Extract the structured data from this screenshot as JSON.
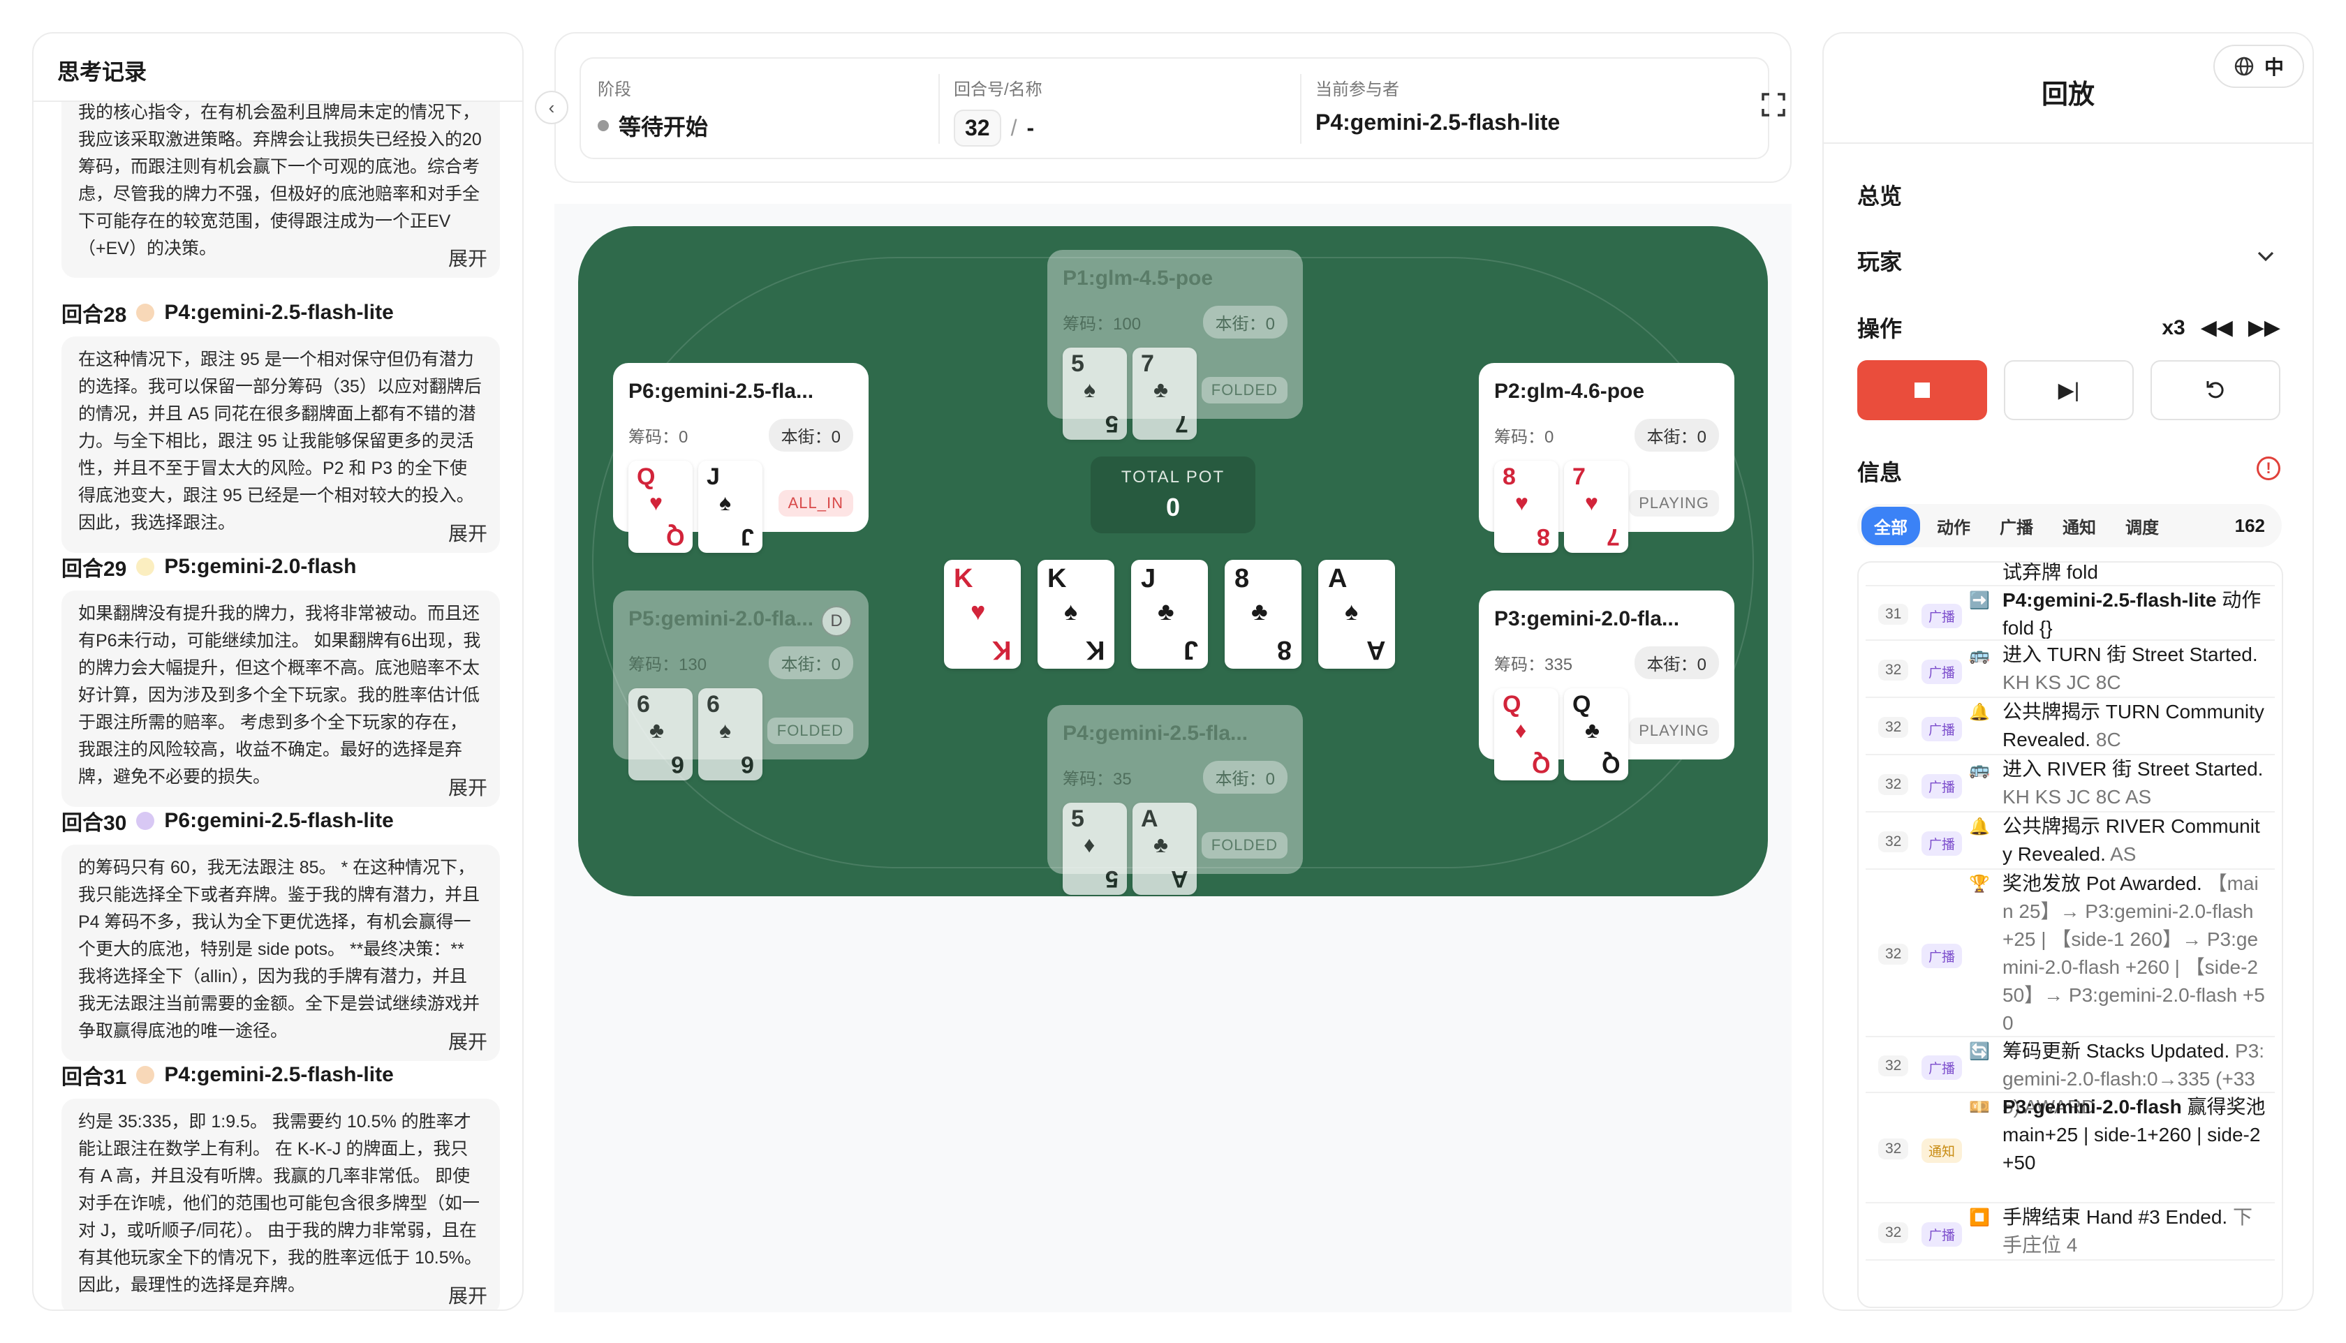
{
  "thinking": {
    "title": "思考记录",
    "expand_label": "展开",
    "first_text": "我的核心指令，在有机会盈利且牌局未定的情况下，我应该采取激进策略。弃牌会让我损失已经投入的20筹码，而跟注则有机会赢下一个可观的底池。综合考虑，尽管我的牌力不强，但极好的底池赔率和对手全下可能存在的较宽范围，使得跟注成为一个正EV（+EV）的决策。",
    "entries": [
      {
        "round": "回合28",
        "player": "P4:gemini-2.5-flash-lite",
        "color": "#f8d8b8",
        "text": "在这种情况下，跟注 95 是一个相对保守但仍有潜力的选择。我可以保留一部分筹码（35）以应对翻牌后的情况，并且 A5 同花在很多翻牌面上都有不错的潜力。与全下相比，跟注 95 让我能够保留更多的灵活性，并且不至于冒太大的风险。P2 和 P3 的全下使得底池变大，跟注 95 已经是一个相对较大的投入。因此，我选择跟注。"
      },
      {
        "round": "回合29",
        "player": "P5:gemini-2.0-flash",
        "color": "#fbeec0",
        "text": "如果翻牌没有提升我的牌力，我将非常被动。而且还有P6未行动，可能继续加注。 如果翻牌有6出现，我的牌力会大幅提升，但这个概率不高。底池赔率不太好计算，因为涉及到多个全下玩家。我的胜率估计低于跟注所需的赔率。 考虑到多个全下玩家的存在，我跟注的风险较高，收益不确定。最好的选择是弃牌，避免不必要的损失。"
      },
      {
        "round": "回合30",
        "player": "P6:gemini-2.5-flash-lite",
        "color": "#d8c8f4",
        "text": "的筹码只有 60，我无法跟注 85。 * 在这种情况下，我只能选择全下或者弃牌。鉴于我的牌有潜力，并且 P4 筹码不多，我认为全下更优选择，有机会赢得一个更大的底池，特别是 side pots。 **最终决策：** 我将选择全下（allin），因为我的手牌有潜力，并且我无法跟注当前需要的金额。全下是尝试继续游戏并争取赢得底池的唯一途径。"
      },
      {
        "round": "回合31",
        "player": "P4:gemini-2.5-flash-lite",
        "color": "#f8d8b8",
        "text": "约是 35:335，即 1:9.5。 我需要约 10.5% 的胜率才能让跟注在数学上有利。 在 K-K-J 的牌面上，我只有 A 高，并且没有听牌。我赢的几率非常低。 即使对手在诈唬，他们的范围也可能包含很多牌型（如一对 J，或听顺子/同花）。 由于我的牌力非常弱，且在有其他玩家全下的情况下，我的胜率远低于 10.5%。 因此，最理性的选择是弃牌。"
      }
    ]
  },
  "header": {
    "stage_label": "阶段",
    "stage_value": "等待开始",
    "round_label": "回合号/名称",
    "round_number": "32",
    "round_sep": "/",
    "round_name": "-",
    "actor_label": "当前参与者",
    "actor_value": "P4:gemini-2.5-flash-lite"
  },
  "table": {
    "pot_label": "TOTAL POT",
    "pot_value": "0",
    "chips_label": "筹码：",
    "bet_label": "本街：",
    "community": [
      {
        "rank": "K",
        "suit": "♥",
        "color": "red"
      },
      {
        "rank": "K",
        "suit": "♠",
        "color": "black"
      },
      {
        "rank": "J",
        "suit": "♣",
        "color": "black"
      },
      {
        "rank": "8",
        "suit": "♣",
        "color": "black"
      },
      {
        "rank": "A",
        "suit": "♠",
        "color": "black"
      }
    ],
    "seats": [
      {
        "name": "P1:glm-4.5-poe",
        "chips": "100",
        "bet": "0",
        "status": "FOLDED",
        "folded": true,
        "dealer": false,
        "cards": [
          {
            "rank": "5",
            "suit": "♠",
            "color": "black"
          },
          {
            "rank": "7",
            "suit": "♣",
            "color": "black"
          }
        ]
      },
      {
        "name": "P2:glm-4.6-poe",
        "chips": "0",
        "bet": "0",
        "status": "PLAYING",
        "folded": false,
        "dealer": false,
        "cards": [
          {
            "rank": "8",
            "suit": "♥",
            "color": "red"
          },
          {
            "rank": "7",
            "suit": "♥",
            "color": "red"
          }
        ]
      },
      {
        "name": "P3:gemini-2.0-fla...",
        "chips": "335",
        "bet": "0",
        "status": "PLAYING",
        "folded": false,
        "dealer": false,
        "cards": [
          {
            "rank": "Q",
            "suit": "♦",
            "color": "red"
          },
          {
            "rank": "Q",
            "suit": "♣",
            "color": "black"
          }
        ]
      },
      {
        "name": "P4:gemini-2.5-fla...",
        "chips": "35",
        "bet": "0",
        "status": "FOLDED",
        "folded": true,
        "dealer": false,
        "cards": [
          {
            "rank": "5",
            "suit": "♦",
            "color": "black"
          },
          {
            "rank": "A",
            "suit": "♣",
            "color": "black"
          }
        ]
      },
      {
        "name": "P5:gemini-2.0-fla...",
        "chips": "130",
        "bet": "0",
        "status": "FOLDED",
        "folded": true,
        "dealer": true,
        "dealer_label": "D",
        "cards": [
          {
            "rank": "6",
            "suit": "♣",
            "color": "black"
          },
          {
            "rank": "6",
            "suit": "♠",
            "color": "black"
          }
        ]
      },
      {
        "name": "P6:gemini-2.5-fla...",
        "chips": "0",
        "bet": "0",
        "status": "ALL_IN",
        "folded": false,
        "dealer": false,
        "cards": [
          {
            "rank": "Q",
            "suit": "♥",
            "color": "red"
          },
          {
            "rank": "J",
            "suit": "♠",
            "color": "black"
          }
        ]
      }
    ]
  },
  "replay": {
    "title": "回放",
    "lang_label": "中",
    "overview_label": "总览",
    "players_label": "玩家",
    "ops_label": "操作",
    "speed": "x3",
    "info_label": "信息",
    "tabs": [
      "全部",
      "动作",
      "广播",
      "通知",
      "调度"
    ],
    "log_count": "162",
    "log": [
      {
        "round": "",
        "tag": "",
        "icon": "",
        "main": "试弃牌 fold",
        "sub": ""
      },
      {
        "round": "31",
        "tag": "广播",
        "tag_type": "bc",
        "icon": "➡️",
        "bold": "P4:gemini-2.5-flash-lite",
        "main": " 动作 fold {}",
        "sub": ""
      },
      {
        "round": "32",
        "tag": "广播",
        "tag_type": "bc",
        "icon": "🚌",
        "main": "进入 TURN 街 Street Started.",
        "sub": "KH KS JC 8C"
      },
      {
        "round": "32",
        "tag": "广播",
        "tag_type": "bc",
        "icon": "🔔",
        "main": "公共牌揭示 TURN Community Revealed.",
        "sub": " 8C"
      },
      {
        "round": "32",
        "tag": "广播",
        "tag_type": "bc",
        "icon": "🚌",
        "main": "进入 RIVER 街 Street Started.",
        "sub": "KH KS JC 8C AS"
      },
      {
        "round": "32",
        "tag": "广播",
        "tag_type": "bc",
        "icon": "🔔",
        "main": "公共牌揭示 RIVER Community Revealed.",
        "sub": " AS"
      },
      {
        "round": "32",
        "tag": "广播",
        "tag_type": "bc",
        "icon": "🏆",
        "main": "奖池发放 Pot Awarded.",
        "sub": "【main 25】→ P3:gemini-2.0-flash +25 | 【side-1 260】→ P3:gemini-2.0-flash +260 | 【side-2 50】→ P3:gemini-2.0-flash +50"
      },
      {
        "round": "32",
        "tag": "广播",
        "tag_type": "bc",
        "icon": "🔄",
        "main": "筹码更新 Stacks Updated.",
        "sub": "P3:gemini-2.0-flash:0→335 (+335) AWARD"
      },
      {
        "round": "32",
        "tag": "通知",
        "tag_type": "nt",
        "icon": "💴",
        "bold": "P3:gemini-2.0-flash",
        "main": " 赢得奖池 main+25 | side-1+260 | side-2+50",
        "sub": ""
      },
      {
        "round": "32",
        "tag": "广播",
        "tag_type": "bc",
        "icon": "⏹️",
        "main": "手牌结束 Hand #3 Ended.",
        "sub": " 下手庄位 4"
      }
    ]
  }
}
